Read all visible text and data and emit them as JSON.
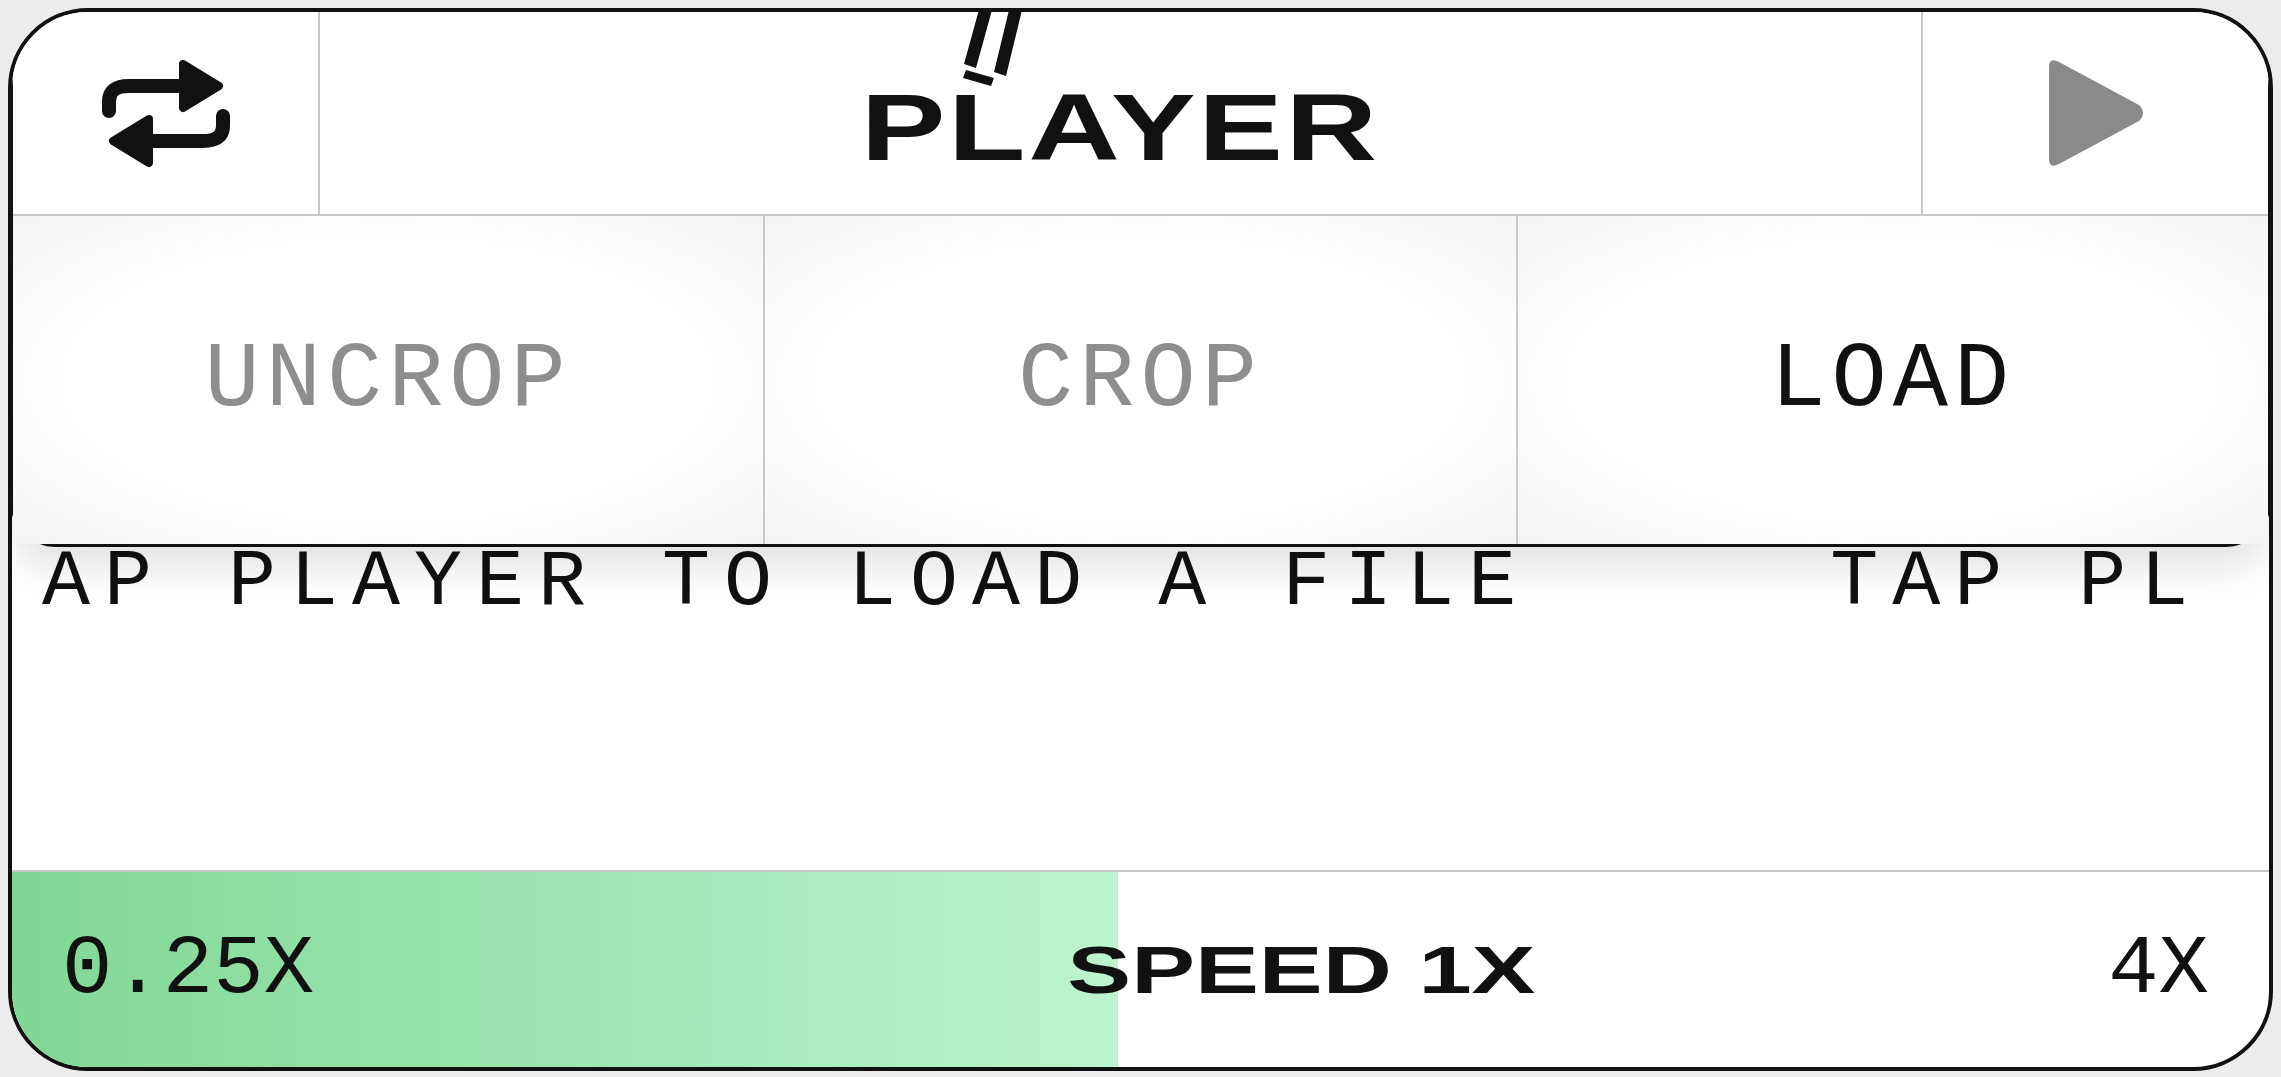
{
  "header": {
    "title": "PLAYER",
    "play": {
      "disabled": true
    }
  },
  "buttons": [
    {
      "label": "UNCROP",
      "disabled": true
    },
    {
      "label": "CROP",
      "disabled": true
    },
    {
      "label": "LOAD",
      "disabled": false
    }
  ],
  "marquee": [
    "AP PLAYER TO LOAD A FILE",
    "TAP PL"
  ],
  "speed": {
    "min": "0.25X",
    "label": "SPEED 1X",
    "max": "4X",
    "level": 0.49
  }
}
